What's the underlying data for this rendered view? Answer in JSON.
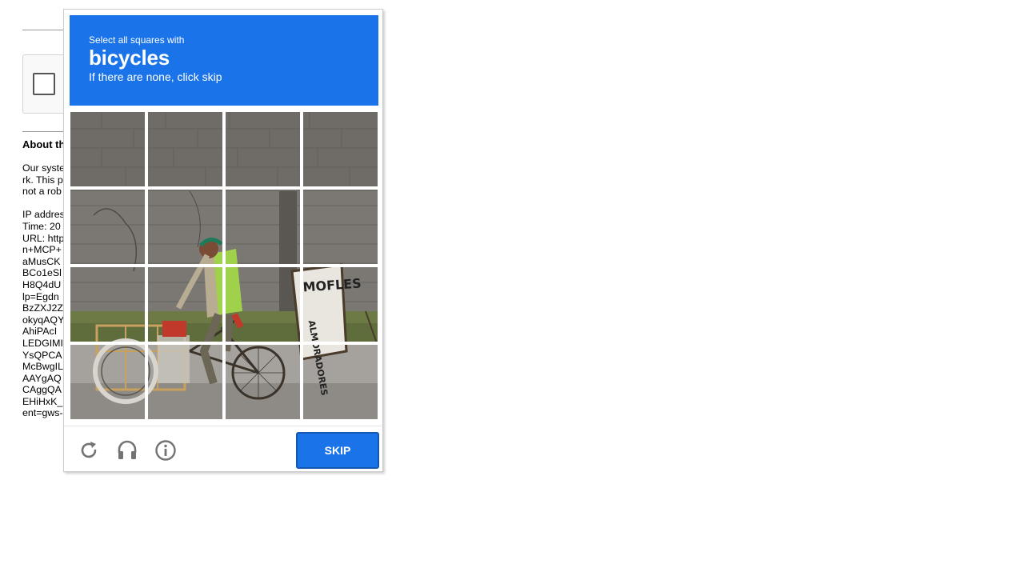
{
  "background_page": {
    "about_title": "About th",
    "lines": [
      "Our syste",
      "rk. This p",
      "not a rob",
      "",
      "IP addres",
      "Time: 20",
      "URL: http",
      "n+MCP+",
      "aMusCK",
      "BCo1eSl",
      "H8Q4dU",
      "lp=Egdn",
      "BzZXJ2Z",
      "okyqAQY",
      "AhiPAcI",
      "LEDGIMI",
      "YsQPCA",
      "McBwgIL",
      "AAYgAQ",
      "CAggQA",
      "EHiHxK_",
      "ent=gws-"
    ]
  },
  "challenge": {
    "header": {
      "instruction": "Select all squares with",
      "target": "bicycles",
      "hint": "If there are none, click skip"
    },
    "grid": {
      "rows": 4,
      "columns": 4,
      "selected_tiles": []
    },
    "footer": {
      "reload_icon": "reload-icon",
      "audio_icon": "headphones-icon",
      "info_icon": "info-icon",
      "skip_label": "SKIP"
    }
  },
  "colors": {
    "accent": "#1a73e8",
    "icon_gray": "#737373"
  }
}
